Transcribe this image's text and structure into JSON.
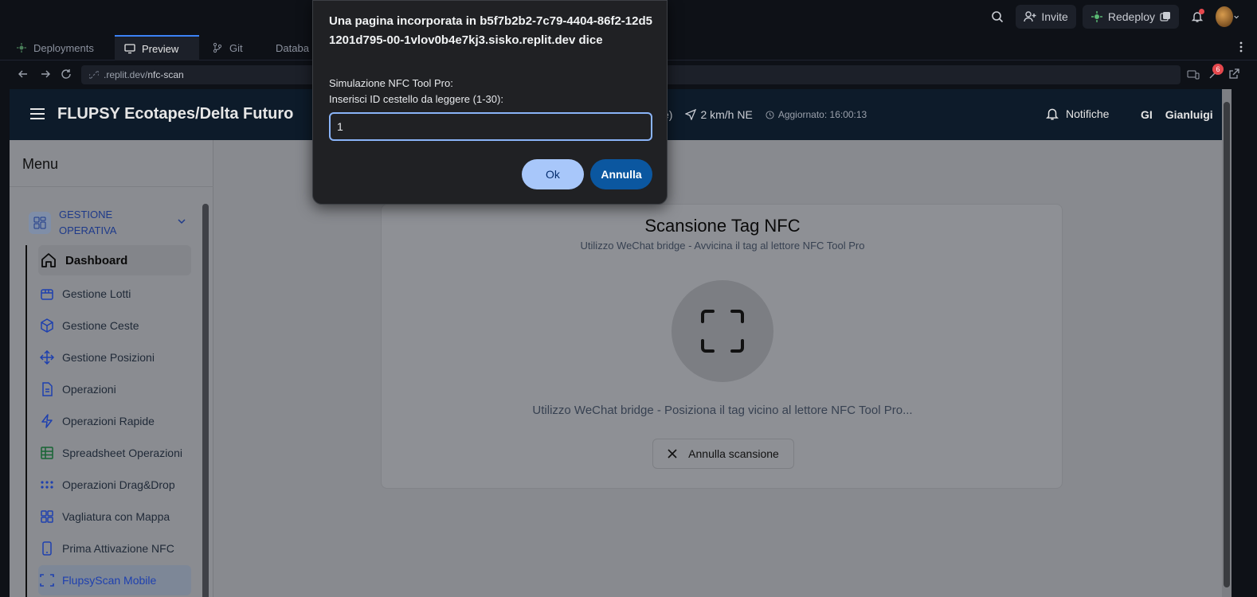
{
  "topbar": {
    "invite_label": "Invite",
    "redeploy_label": "Redeploy"
  },
  "tabs": [
    {
      "label": "Deployments"
    },
    {
      "label": "Preview"
    },
    {
      "label": "Git"
    },
    {
      "label": "Databa"
    }
  ],
  "url": {
    "host": ".replit.dev/",
    "path": "nfc-scan"
  },
  "app": {
    "title": "FLUPSY Ecotapes/Delta Futuro",
    "weather_partial": "e)",
    "wind": "2 km/h NE",
    "updated": "Aggiornato: 16:00:13",
    "notifications_label": "Notifiche",
    "user_initials": "GI",
    "user_name": "Gianluigi"
  },
  "sidebar": {
    "title": "Menu",
    "section_label": "GESTIONE OPERATIVA",
    "items": [
      {
        "label": "Dashboard",
        "icon": "home-icon"
      },
      {
        "label": "Gestione Lotti",
        "icon": "box-icon"
      },
      {
        "label": "Gestione Ceste",
        "icon": "package-icon"
      },
      {
        "label": "Gestione Posizioni",
        "icon": "move-icon"
      },
      {
        "label": "Operazioni",
        "icon": "document-icon"
      },
      {
        "label": "Operazioni Rapide",
        "icon": "lightning-icon"
      },
      {
        "label": "Spreadsheet Operazioni",
        "icon": "table-icon"
      },
      {
        "label": "Operazioni Drag&Drop",
        "icon": "grip-icon"
      },
      {
        "label": "Vagliatura con Mappa",
        "icon": "grid-icon"
      },
      {
        "label": "Prima Attivazione NFC",
        "icon": "phone-icon"
      },
      {
        "label": "FlupsyScan Mobile",
        "icon": "scan-icon"
      }
    ]
  },
  "scan": {
    "title": "Scansione Tag NFC",
    "subtitle": "Utilizzo WeChat bridge - Avvicina il tag al lettore NFC Tool Pro",
    "status": "Utilizzo WeChat bridge - Posiziona il tag vicino al lettore NFC Tool Pro...",
    "cancel_label": "Annulla scansione"
  },
  "dialog": {
    "title": "Una pagina incorporata in b5f7b2b2-7c79-4404-86f2-12d51201d795-00-1vlov0b4e7kj3.sisko.replit.dev dice",
    "line1": "Simulazione NFC Tool Pro:",
    "line2": "Inserisci ID cestello da leggere (1-30):",
    "input_value": "1",
    "ok_label": "Ok",
    "cancel_label": "Annulla"
  },
  "colors": {
    "accent": "#8ab4f8",
    "ok_button": "#a8c7fa",
    "cancel_button": "#0b57a0",
    "app_header": "#0d1b2a"
  }
}
